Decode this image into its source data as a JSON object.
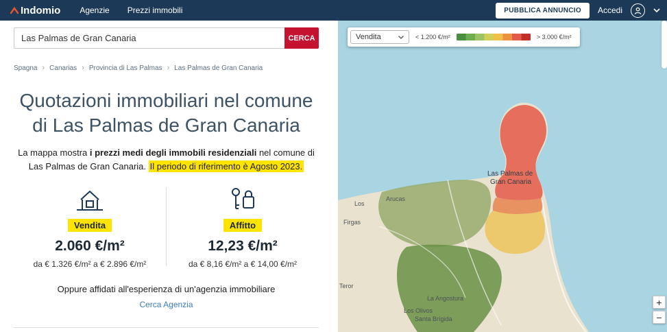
{
  "header": {
    "logo_text": "Indomio",
    "nav_agenzie": "Agenzie",
    "nav_prezzi": "Prezzi immobili",
    "publish_button": "PUBBLICA ANNUNCIO",
    "login_label": "Accedi"
  },
  "search": {
    "value": "Las Palmas de Gran Canaria",
    "button_label": "CERCA"
  },
  "breadcrumb": {
    "separator": "›",
    "items": [
      "Spagna",
      "Canarias",
      "Provincia di Las Palmas",
      "Las Palmas de Gran Canaria"
    ]
  },
  "quotes": {
    "title": "Quotazioni immobiliari nel comune di Las Palmas de Gran Canaria",
    "intro_1": "La mappa mostra ",
    "intro_bold": "i prezzi medi degli immobili residenziali",
    "intro_2": " nel comune di Las Palmas de Gran Canaria. ",
    "intro_highlight": "Il periodo di riferimento è Agosto 2023.",
    "sale": {
      "label": "Vendita",
      "price": "2.060 €/m²",
      "range": "da € 1.326 €/m² a € 2.896 €/m²"
    },
    "rent": {
      "label": "Affitto",
      "price": "12,23 €/m²",
      "range": "da € 8,16 €/m² a € 14,00 €/m²"
    },
    "agency_text": "Oppure affidati all'esperienza di un'agenzia immobiliare",
    "agency_link": "Cerca Agenzia"
  },
  "map": {
    "filter_value": "Vendita",
    "legend_min": "< 1.200 €/m²",
    "legend_max": "> 3.000 €/m²",
    "zoom_in": "+",
    "zoom_out": "−",
    "labels": {
      "city_line1": "Las Palmas de",
      "city_line2": "Gran Canaria",
      "arucas": "Arucas",
      "firgas": "Firgas",
      "los": "Los",
      "teror": "Teror",
      "la_angostura": "La Angostura",
      "los_olivos": "Los Olivos",
      "santa_brigida": "Santa Brígida"
    },
    "legend_gradient": [
      "#4a8f3f",
      "#6fae4e",
      "#9cc465",
      "#d2cf56",
      "#f0c04a",
      "#ef9143",
      "#e25b4a",
      "#c03028"
    ]
  },
  "colors": {
    "header_bg": "#1c3a57",
    "accent_red": "#c41230",
    "highlight_yellow": "#ffe400",
    "link_blue": "#3d7dc4",
    "sea": "#a9d4e2",
    "land": "#e9e2cf"
  }
}
